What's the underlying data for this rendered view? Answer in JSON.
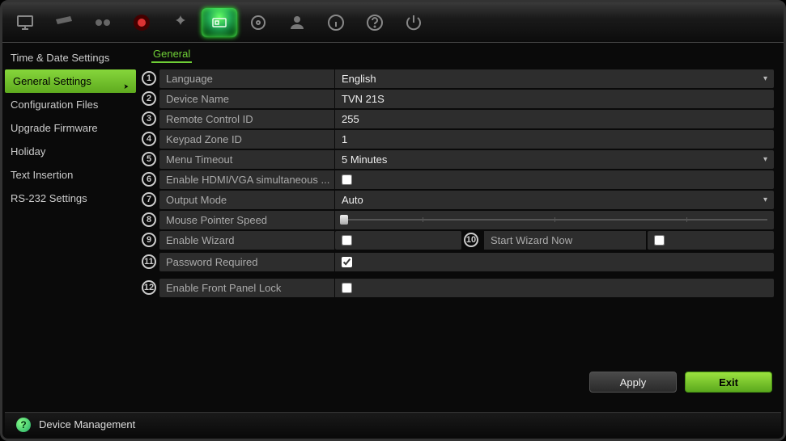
{
  "toolbar_icons": [
    "monitor",
    "card",
    "gauges",
    "record",
    "motion",
    "system",
    "disk",
    "user",
    "info",
    "help",
    "power"
  ],
  "toolbar_active_index": 5,
  "sidebar": {
    "items": [
      {
        "label": "Time & Date Settings"
      },
      {
        "label": "General Settings"
      },
      {
        "label": "Configuration Files"
      },
      {
        "label": "Upgrade Firmware"
      },
      {
        "label": "Holiday"
      },
      {
        "label": "Text Insertion"
      },
      {
        "label": "RS-232 Settings"
      }
    ],
    "active_index": 1
  },
  "tab": {
    "label": "General"
  },
  "rows": [
    {
      "n": "1",
      "label": "Language",
      "value": "English",
      "type": "dropdown"
    },
    {
      "n": "2",
      "label": "Device Name",
      "value": "TVN 21S",
      "type": "text"
    },
    {
      "n": "3",
      "label": "Remote Control ID",
      "value": "255",
      "type": "text"
    },
    {
      "n": "4",
      "label": "Keypad Zone ID",
      "value": "1",
      "type": "text"
    },
    {
      "n": "5",
      "label": "Menu Timeout",
      "value": "5 Minutes",
      "type": "dropdown"
    },
    {
      "n": "6",
      "label": "Enable HDMI/VGA simultaneous ...",
      "checked": false,
      "type": "checkbox"
    },
    {
      "n": "7",
      "label": "Output Mode",
      "value": "Auto",
      "type": "dropdown"
    },
    {
      "n": "8",
      "label": "Mouse Pointer Speed",
      "type": "slider"
    },
    {
      "n": "9",
      "label": "Enable Wizard",
      "checked": false,
      "type": "wizard",
      "n2": "10",
      "label2": "Start Wizard Now",
      "checked2": false
    },
    {
      "n": "11",
      "label": "Password Required",
      "checked": true,
      "type": "checkbox"
    },
    {
      "n": "12",
      "label": "Enable Front Panel Lock",
      "checked": false,
      "type": "checkbox"
    }
  ],
  "buttons": {
    "apply": "Apply",
    "exit": "Exit"
  },
  "status": {
    "title": "Device Management"
  }
}
